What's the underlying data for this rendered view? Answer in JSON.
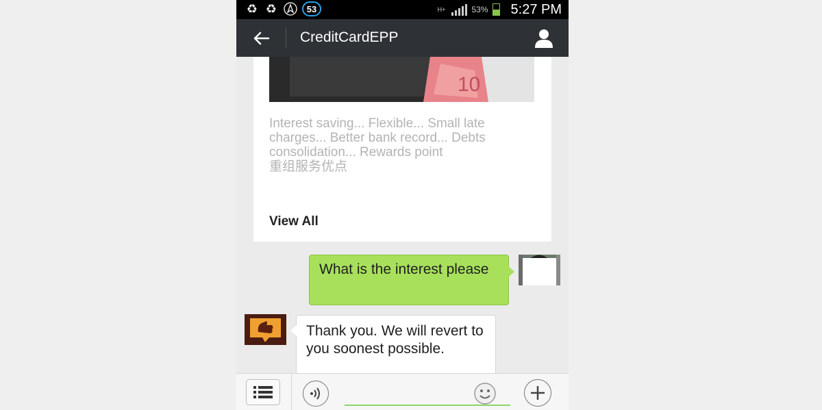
{
  "status_bar": {
    "badge_count": "53",
    "network": "H+",
    "battery_percent": "53%",
    "time": "5:27 PM",
    "icons": [
      "recycle-icon",
      "recycle-icon",
      "nav-arrow-icon",
      "notification-badge",
      "signal-icon",
      "battery-icon"
    ]
  },
  "app_bar": {
    "title": "CreditCardEPP",
    "back_icon": "arrow-left-icon",
    "profile_icon": "person-icon"
  },
  "card": {
    "description": "Interest saving... Flexible... Small late charges... Better bank record... Debts consolidation... Rewards point",
    "description_cn": "重组服务优点",
    "view_all": "View All"
  },
  "messages": [
    {
      "direction": "outgoing",
      "text": "What is the interest please"
    },
    {
      "direction": "incoming",
      "text": "Thank you. We will revert to you soonest possible."
    }
  ],
  "input_bar": {
    "menu_icon": "list-icon",
    "voice_icon": "voice-icon",
    "emoji_icon": "smiley-icon",
    "plus_icon": "plus-icon",
    "placeholder": ""
  },
  "colors": {
    "app_bar": "#2e3236",
    "outgoing_bubble": "#a8e05c",
    "incoming_bubble": "#ffffff",
    "input_underline": "#8ed46a"
  }
}
